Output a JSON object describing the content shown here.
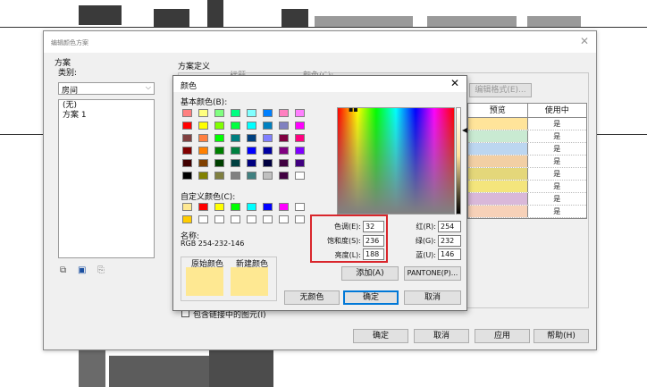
{
  "main_dialog": {
    "title": "编辑颜色方案",
    "scheme_label": "方案",
    "category_label": "类别:",
    "category_value": "房间",
    "scheme_list": [
      "(无)",
      "方案 1"
    ],
    "definition_label": "方案定义",
    "col_title": "标题",
    "col_color": "颜色(C):",
    "format_button": "编辑格式(E)...",
    "include_linked": "包含链接中的图元(I)",
    "ok": "确定",
    "cancel": "取消",
    "apply": "应用",
    "help": "帮助(H)",
    "table": {
      "headers": [
        "预览",
        "使用中"
      ],
      "rows": [
        {
          "swatch": "#ffe49a",
          "in_use": "是"
        },
        {
          "swatch": "#c9ead2",
          "in_use": "是"
        },
        {
          "swatch": "#bcd6f0",
          "in_use": "是"
        },
        {
          "swatch": "#f2cfa4",
          "in_use": "是"
        },
        {
          "swatch": "#e4d77a",
          "in_use": "是"
        },
        {
          "swatch": "#f4e57c",
          "in_use": "是"
        },
        {
          "swatch": "#d9b8d9",
          "in_use": "是"
        },
        {
          "swatch": "#f7d1b8",
          "in_use": "是"
        }
      ]
    }
  },
  "color_dialog": {
    "title": "颜色",
    "basic_colors_label": "基本颜色(B):",
    "custom_colors_label": "自定义颜色(C):",
    "name_label": "名称:",
    "name_value": "RGB 254-232-146",
    "original_label": "原始颜色",
    "new_label": "新建颜色",
    "preview_color": "#fee892",
    "hue_label": "色调(E):",
    "hue": "32",
    "sat_label": "饱和度(S):",
    "sat": "236",
    "lum_label": "亮度(L):",
    "lum": "188",
    "red_label": "红(R):",
    "red": "254",
    "green_label": "绿(G):",
    "green": "232",
    "blue_label": "蓝(U):",
    "blue": "146",
    "add_button": "添加(A)",
    "pantone_button": "PANTONE(P)...",
    "no_color_button": "无颜色",
    "ok": "确定",
    "cancel": "取消",
    "basic_colors": [
      [
        "#ff8080",
        "#ffff80",
        "#80ff80",
        "#00ff80",
        "#80ffff",
        "#0080ff",
        "#ff80c0",
        "#ff80ff"
      ],
      [
        "#ff0000",
        "#ffff00",
        "#80ff00",
        "#00ff40",
        "#00ffff",
        "#0080c0",
        "#8080c0",
        "#ff00ff"
      ],
      [
        "#804040",
        "#ff8040",
        "#00ff00",
        "#008080",
        "#004080",
        "#8080ff",
        "#800040",
        "#ff0080"
      ],
      [
        "#800000",
        "#ff8000",
        "#008000",
        "#008040",
        "#0000ff",
        "#0000a0",
        "#800080",
        "#8000ff"
      ],
      [
        "#400000",
        "#804000",
        "#004000",
        "#004040",
        "#000080",
        "#000040",
        "#400040",
        "#400080"
      ],
      [
        "#000000",
        "#808000",
        "#808040",
        "#808080",
        "#408080",
        "#c0c0c0",
        "#400040",
        "#ffffff"
      ]
    ],
    "custom_colors": [
      [
        "#fee892",
        "#ff0000",
        "#ffff00",
        "#00ff00",
        "#00ffff",
        "#0000ff",
        "#ff00ff",
        "#ffffff"
      ],
      [
        "#ffcc00",
        "#ffffff",
        "#ffffff",
        "#ffffff",
        "#ffffff",
        "#ffffff",
        "#ffffff",
        "#ffffff"
      ]
    ]
  }
}
